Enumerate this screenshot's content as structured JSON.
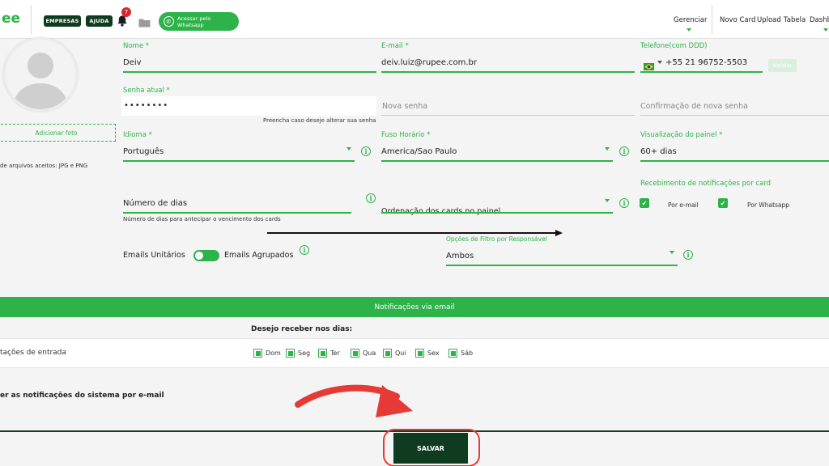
{
  "header": {
    "logo_text": "ee",
    "buttons": {
      "empresas": "EMPRESAS",
      "ajuda": "AJUDA"
    },
    "notification_count": "7",
    "whatsapp_label": "Acessar pelo Whatsapp",
    "nav": {
      "gerenciar": "Gerenciar",
      "novo_card": "Novo Card",
      "upload": "Upload",
      "tabela": "Tabela",
      "dashboard": "Dashb"
    }
  },
  "profile": {
    "add_photo": "Adicionar foto",
    "file_types": "de arquivos aceitos: JPG e PNG"
  },
  "form": {
    "name": {
      "label": "Nome *",
      "value": "Deiv"
    },
    "email": {
      "label": "E-mail *",
      "value": "deiv.luiz@rupee.com.br"
    },
    "phone": {
      "label": "Telefone(com DDD)",
      "value": "+55 21 96752-5503",
      "validate": "Validar"
    },
    "current_password": {
      "label": "Senha atual *",
      "value": "••••••••",
      "hint": "Preencha caso deseje alterar sua senha"
    },
    "new_password": {
      "placeholder": "Nova senha"
    },
    "confirm_password": {
      "placeholder": "Confirmação de nova senha"
    },
    "language": {
      "label": "Idioma *",
      "value": "Português"
    },
    "timezone": {
      "label": "Fuso Horário *",
      "value": "America/Sao Paulo"
    },
    "panel_view": {
      "label": "Visualização do painel *",
      "value": "60+ dias"
    },
    "card_notifications": {
      "label": "Recebimento de notificações por card",
      "email": "Por e-mail",
      "whatsapp": "Por Whatsapp"
    },
    "days": {
      "value": "Número de dias",
      "hint": "Número de dias para antecipar o vencimento dos cards"
    },
    "card_order": {
      "value": "Ordenação dos cards no painel"
    },
    "emails": {
      "unitary": "Emails Unitários",
      "grouped": "Emails Agrupados"
    },
    "filter": {
      "label": "Opções de Filtro por Responsável",
      "value": "Ambos"
    }
  },
  "email_notifications": {
    "banner": "Notificações via email",
    "receive_days": "Desejo receber nos dias:",
    "row_label": "tações de entrada",
    "days": [
      "Dom",
      "Seg",
      "Ter",
      "Qua",
      "Qui",
      "Sex",
      "Sáb"
    ],
    "system_text": "er as notificações do sistema por e-mail"
  },
  "save_label": "SALVAR",
  "colors": {
    "brand_green": "#2db34a",
    "dark_green": "#0f3b1e",
    "annotation_red": "#e63a36"
  },
  "icons": [
    "bell-icon",
    "folder-icon",
    "whatsapp-icon",
    "info-icon",
    "check-icon",
    "brazil-flag-icon",
    "user-silhouette-icon"
  ]
}
